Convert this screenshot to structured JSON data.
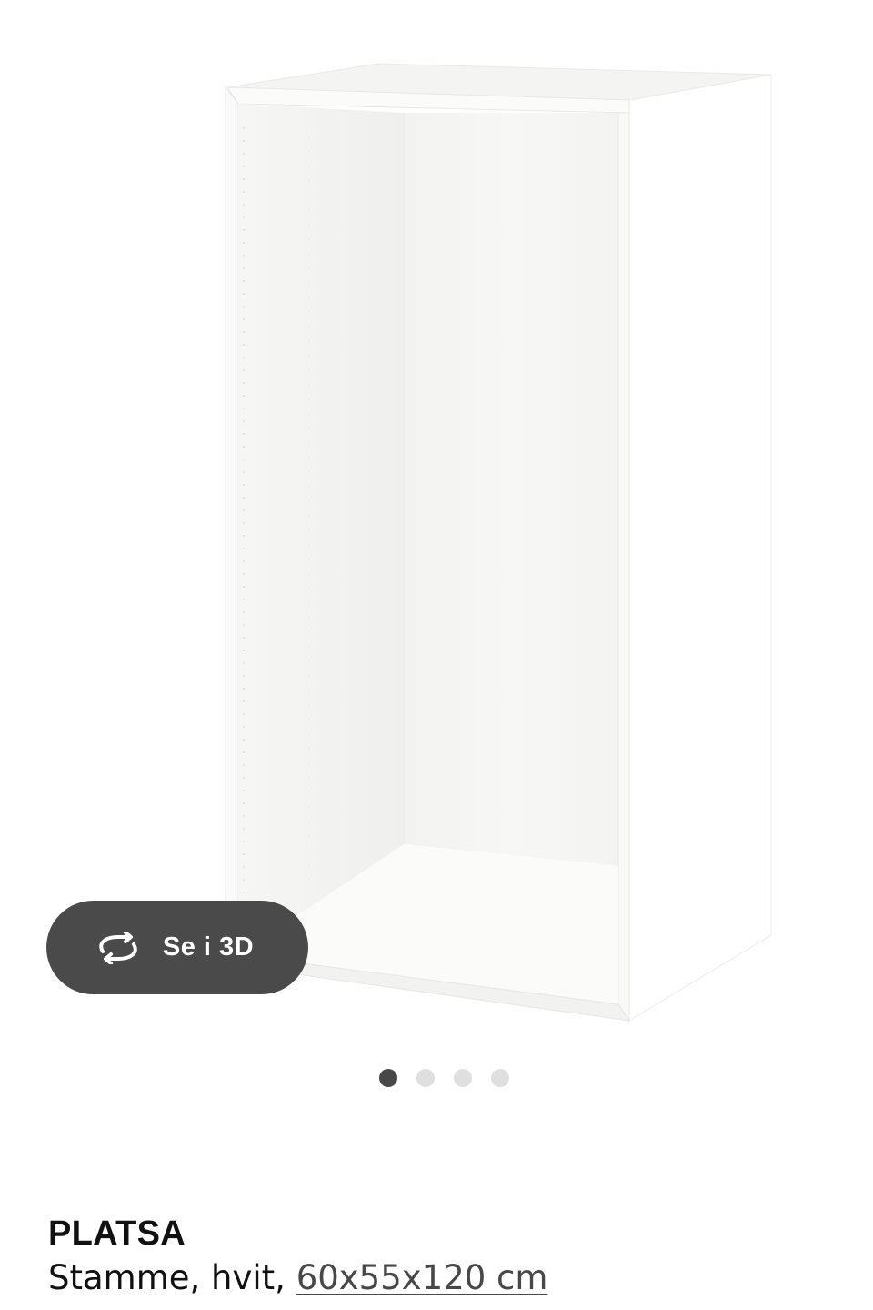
{
  "gallery": {
    "image_alt": "PLATSA Stamme, hvit",
    "view_3d_label": "Se i 3D",
    "view_3d_icon": "rotate-3d-icon",
    "dots_total": 4,
    "active_dot": 1
  },
  "product": {
    "name": "PLATSA",
    "description_prefix": "Stamme, hvit, ",
    "size": "60x55x120 cm"
  },
  "colors": {
    "button_bg": "#4a4a4a",
    "dot_active": "#484848",
    "dot_inactive": "#dfdfdf",
    "text": "#111111"
  }
}
